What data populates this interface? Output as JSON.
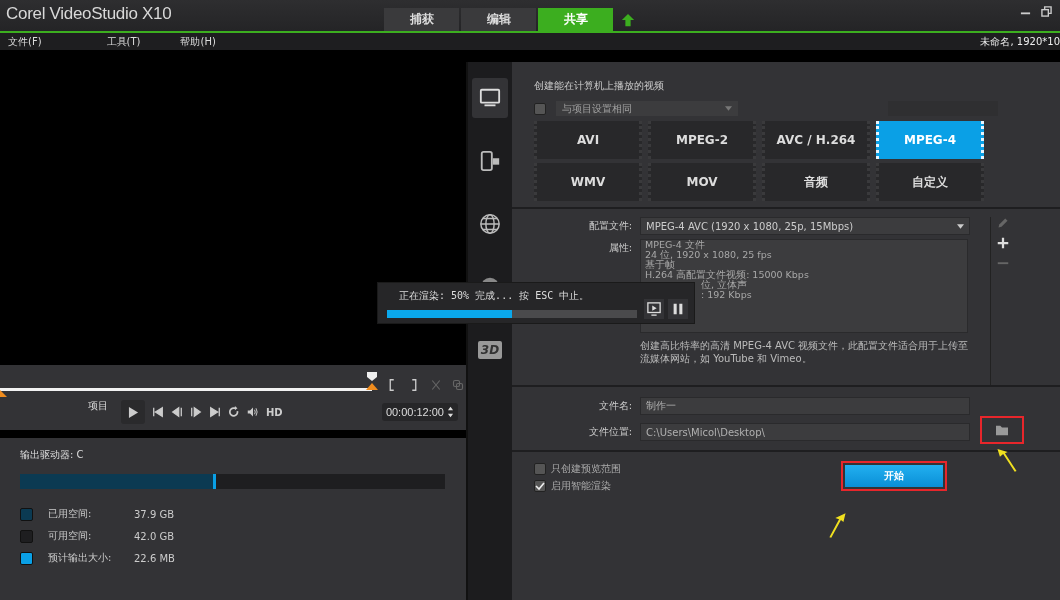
{
  "window": {
    "title": "Corel VideoStudio X10"
  },
  "mode_tabs": [
    {
      "label": "捕获",
      "selected": false
    },
    {
      "label": "编辑",
      "selected": false
    },
    {
      "label": "共享",
      "selected": true
    }
  ],
  "menu": [
    "文件(F)",
    "工具(T)",
    "帮助(H)"
  ],
  "project_info": "未命名, 1920*10",
  "player": {
    "level": 1,
    "project_label": "项目",
    "hd": "HD",
    "timecode": "00:00:12:00"
  },
  "storage": {
    "drive": "输出驱动器: C",
    "level": 0.455,
    "legend": [
      {
        "label": "已用空间:",
        "value": "37.9 GB",
        "color": "#0b3a52"
      },
      {
        "label": "可用空间:",
        "value": "42.0 GB",
        "color": "#1e1e20"
      },
      {
        "label": "预计输出大小:",
        "value": "22.6 MB",
        "color": "#0aa0e6"
      }
    ]
  },
  "render": {
    "message": "正在渲染: 50% 完成... 按 ESC 中止。",
    "level": 0.5
  },
  "categories": [
    {
      "kind": "computer",
      "selected": true
    },
    {
      "kind": "device",
      "selected": false
    },
    {
      "kind": "web",
      "selected": false
    },
    {
      "kind": "disc",
      "selected": false
    },
    {
      "kind": "threed",
      "label": "3D",
      "selected": false
    }
  ],
  "section_title": "创建能在计算机上播放的视频",
  "same_as_project": {
    "label": "与项目设置相同",
    "checked": false
  },
  "formats": [
    {
      "label": "AVI",
      "selected": false
    },
    {
      "label": "MPEG-2",
      "selected": false
    },
    {
      "label": "AVC / H.264",
      "selected": false
    },
    {
      "label": "MPEG-4",
      "selected": true
    },
    {
      "label": "WMV",
      "selected": false
    },
    {
      "label": "MOV",
      "selected": false
    },
    {
      "label": "音频",
      "selected": false
    },
    {
      "label": "自定义",
      "selected": false
    }
  ],
  "profile": {
    "label": "配置文件:",
    "value": "MPEG-4 AVC (1920 x 1080, 25p, 15Mbps)"
  },
  "properties": {
    "label": "属性:",
    "lines": [
      "MPEG-4 文件",
      "24 位, 1920 x 1080, 25 fps",
      "基于帧",
      "H.264 高配置文件视频: 15000 Kbps"
    ],
    "partial_lines": [
      "位, 立体声",
      ": 192 Kbps"
    ]
  },
  "description": "创建高比特率的高清 MPEG-4 AVC 视频文件，此配置文件适合用于上传至流媒体网站，如 YouTube 和 Vimeo。",
  "file_name": {
    "label": "文件名:",
    "value": "制作一"
  },
  "file_location": {
    "label": "文件位置:",
    "value": "C:\\Users\\Micol\\Desktop\\",
    "highlighted": true
  },
  "options": [
    {
      "label": "只创建预览范围",
      "checked": false
    },
    {
      "label": "启用智能渲染",
      "checked": true
    }
  ],
  "start": {
    "label": "开始",
    "highlighted": true
  }
}
